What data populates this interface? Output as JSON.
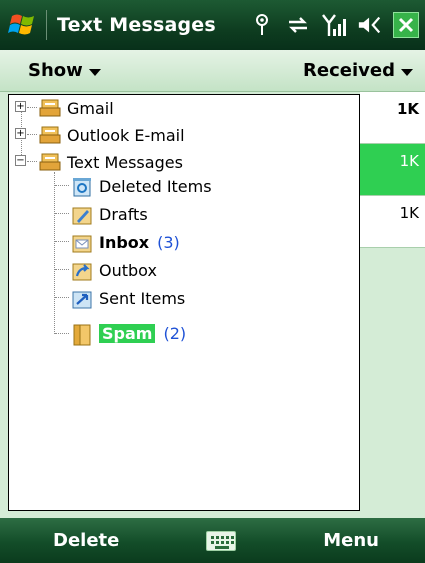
{
  "title_bar": {
    "title": "Text Messages",
    "icons": [
      "windows-start-icon",
      "antenna-icon",
      "connectivity-icon",
      "signal-strength-icon",
      "volume-icon",
      "close-icon"
    ]
  },
  "menu": {
    "left_label": "Show",
    "right_label": "Received"
  },
  "sizes": {
    "header": "1K",
    "row1": "1K",
    "row2": "1K"
  },
  "tree": {
    "items": [
      {
        "label": "Gmail",
        "level": 0,
        "expander": "+"
      },
      {
        "label": "Outlook E-mail",
        "level": 0,
        "expander": "+"
      },
      {
        "label": "Text Messages",
        "level": 0,
        "expander": "−"
      },
      {
        "label": "Deleted Items",
        "level": 1
      },
      {
        "label": "Drafts",
        "level": 1
      },
      {
        "label": "Inbox",
        "level": 1,
        "count": "(3)",
        "bold": true
      },
      {
        "label": "Outbox",
        "level": 1
      },
      {
        "label": "Sent Items",
        "level": 1
      },
      {
        "label": "Spam",
        "level": 1,
        "count": "(2)",
        "selected": true
      }
    ]
  },
  "softkeys": {
    "left": "Delete",
    "right": "Menu"
  },
  "colors": {
    "titlebar": "#0e3d20",
    "selection": "#2fcf52",
    "count_blue": "#1f52d6",
    "menu_strip": "#d4ecd6"
  }
}
